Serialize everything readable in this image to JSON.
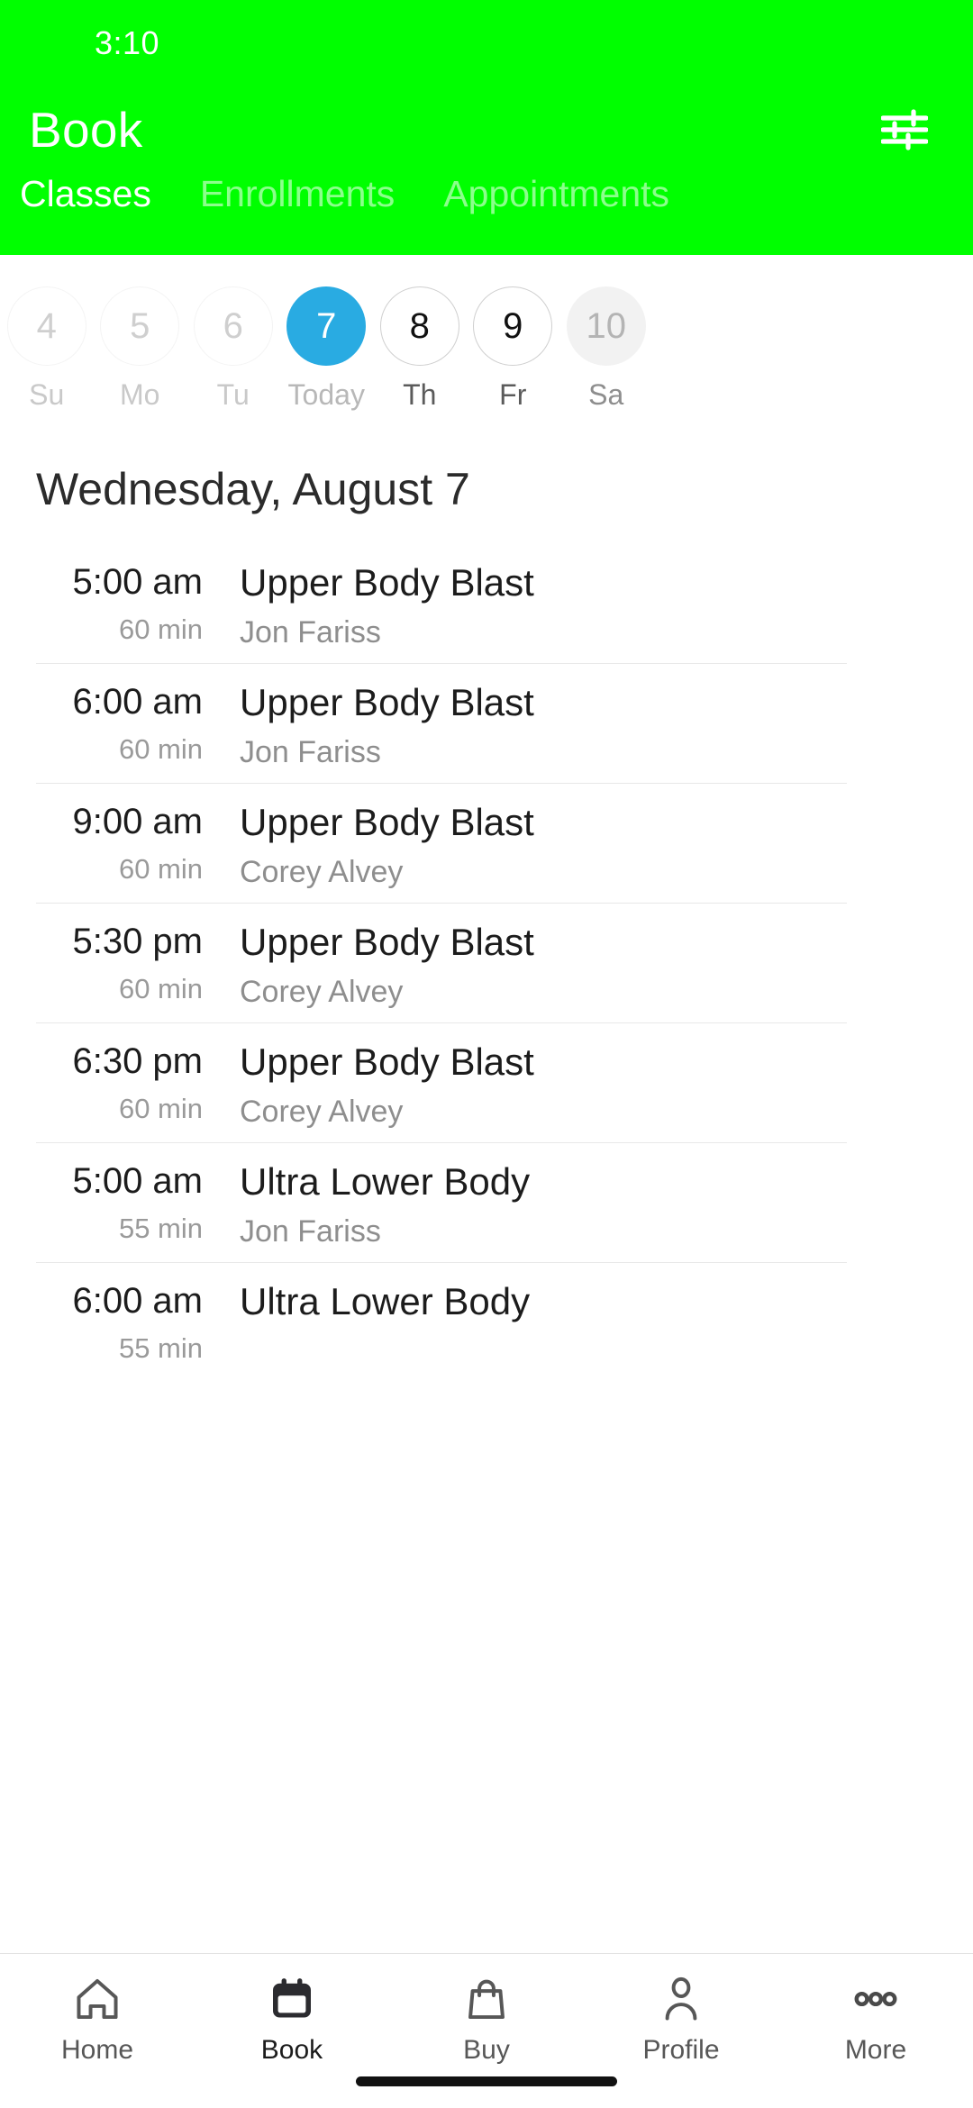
{
  "status_bar": {
    "time": "3:10"
  },
  "header": {
    "title": "Book",
    "filter_icon": "sliders-filter-icon",
    "accent_color": "#00ff00",
    "tabs": [
      {
        "label": "Classes",
        "active": true
      },
      {
        "label": "Enrollments",
        "active": false
      },
      {
        "label": "Appointments",
        "active": false
      }
    ]
  },
  "date_strip": {
    "selected_color": "#29abe2",
    "days": [
      {
        "number": "4",
        "weekday": "Su",
        "state": "past"
      },
      {
        "number": "5",
        "weekday": "Mo",
        "state": "past"
      },
      {
        "number": "6",
        "weekday": "Tu",
        "state": "past"
      },
      {
        "number": "7",
        "weekday": "Today",
        "state": "today"
      },
      {
        "number": "8",
        "weekday": "Th",
        "state": "future"
      },
      {
        "number": "9",
        "weekday": "Fr",
        "state": "future"
      },
      {
        "number": "10",
        "weekday": "Sa",
        "state": "muted"
      }
    ]
  },
  "schedule": {
    "date_heading": "Wednesday, August 7",
    "classes": [
      {
        "time": "5:00 am",
        "duration": "60 min",
        "title": "Upper Body Blast",
        "instructor": "Jon Fariss"
      },
      {
        "time": "6:00 am",
        "duration": "60 min",
        "title": "Upper Body Blast",
        "instructor": "Jon Fariss"
      },
      {
        "time": "9:00 am",
        "duration": "60 min",
        "title": "Upper Body Blast",
        "instructor": "Corey Alvey"
      },
      {
        "time": "5:30 pm",
        "duration": "60 min",
        "title": "Upper Body Blast",
        "instructor": "Corey Alvey"
      },
      {
        "time": "6:30 pm",
        "duration": "60 min",
        "title": "Upper Body Blast",
        "instructor": "Corey Alvey"
      },
      {
        "time": "5:00 am",
        "duration": "55 min",
        "title": "Ultra Lower Body",
        "instructor": "Jon Fariss"
      },
      {
        "time": "6:00 am",
        "duration": "55 min",
        "title": "Ultra Lower Body",
        "instructor": ""
      }
    ]
  },
  "bottom_nav": {
    "items": [
      {
        "label": "Home",
        "icon": "home-icon",
        "active": false
      },
      {
        "label": "Book",
        "icon": "calendar-icon",
        "active": true
      },
      {
        "label": "Buy",
        "icon": "bag-icon",
        "active": false
      },
      {
        "label": "Profile",
        "icon": "person-icon",
        "active": false
      },
      {
        "label": "More",
        "icon": "ellipsis-icon",
        "active": false
      }
    ]
  }
}
